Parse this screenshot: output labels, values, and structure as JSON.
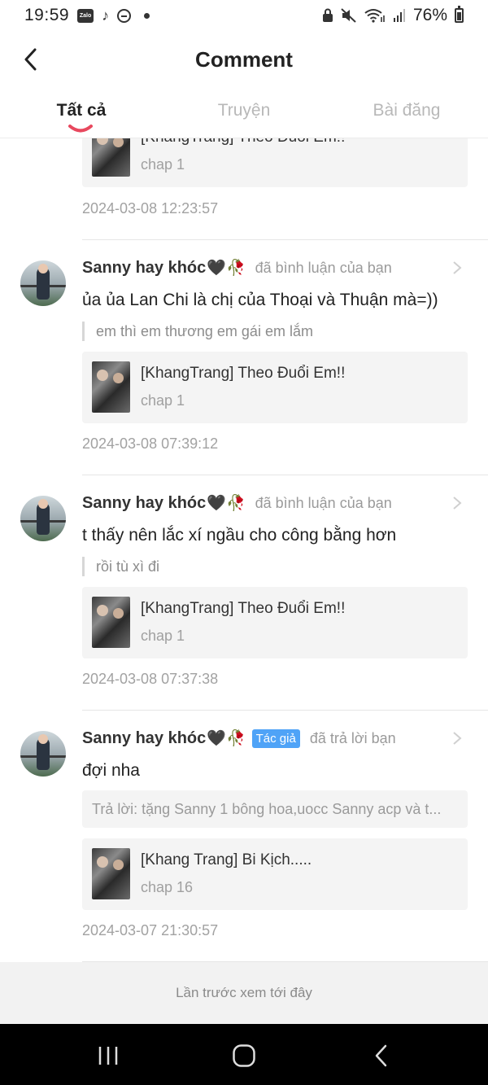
{
  "status_bar": {
    "time": "19:59",
    "zalo_label": "Zalo",
    "battery": "76%"
  },
  "header": {
    "title": "Comment",
    "back_icon": "chevron-left-icon"
  },
  "tabs": [
    {
      "label": "Tất cả",
      "active": true
    },
    {
      "label": "Truyện",
      "active": false
    },
    {
      "label": "Bài đăng",
      "active": false
    }
  ],
  "accent_color": "#e8485e",
  "badge_color": "#4fa3f7",
  "notifications": [
    {
      "story_title": "[KhangTrang] Theo Đuổi Em!!",
      "story_chapter": "chap 1",
      "timestamp": "2024-03-08 12:23:57"
    },
    {
      "user_name": "Sanny hay khóc",
      "name_emoji": "🖤🥀",
      "action": "đã bình luận của bạn",
      "comment": "ủa ủa Lan Chi là chị của Thoại và Thuận mà=))",
      "quote": "em thì em thương em gái em lắm",
      "story_title": "[KhangTrang] Theo Đuổi Em!!",
      "story_chapter": "chap 1",
      "timestamp": "2024-03-08 07:39:12"
    },
    {
      "user_name": "Sanny hay khóc",
      "name_emoji": "🖤🥀",
      "action": "đã bình luận của bạn",
      "comment": "t thấy nên lắc xí ngầu cho công bằng hơn",
      "quote": "rồi tù xì đi",
      "story_title": "[KhangTrang] Theo Đuổi Em!!",
      "story_chapter": "chap 1",
      "timestamp": "2024-03-08 07:37:38"
    },
    {
      "user_name": "Sanny hay khóc",
      "name_emoji": "🖤🥀",
      "badge": "Tác giả",
      "action": "đã trả lời bạn",
      "comment": "đợi nha",
      "reply": "Trả lời: tặng Sanny 1 bông hoa,uocc Sanny acp và t...",
      "story_title": "[Khang Trang] Bi Kịch.....",
      "story_chapter": "chap 16",
      "timestamp": "2024-03-07 21:30:57"
    }
  ],
  "last_seen_label": "Lần trước xem tới đây",
  "nav_icons": [
    "recents-icon",
    "home-icon",
    "back-icon"
  ]
}
